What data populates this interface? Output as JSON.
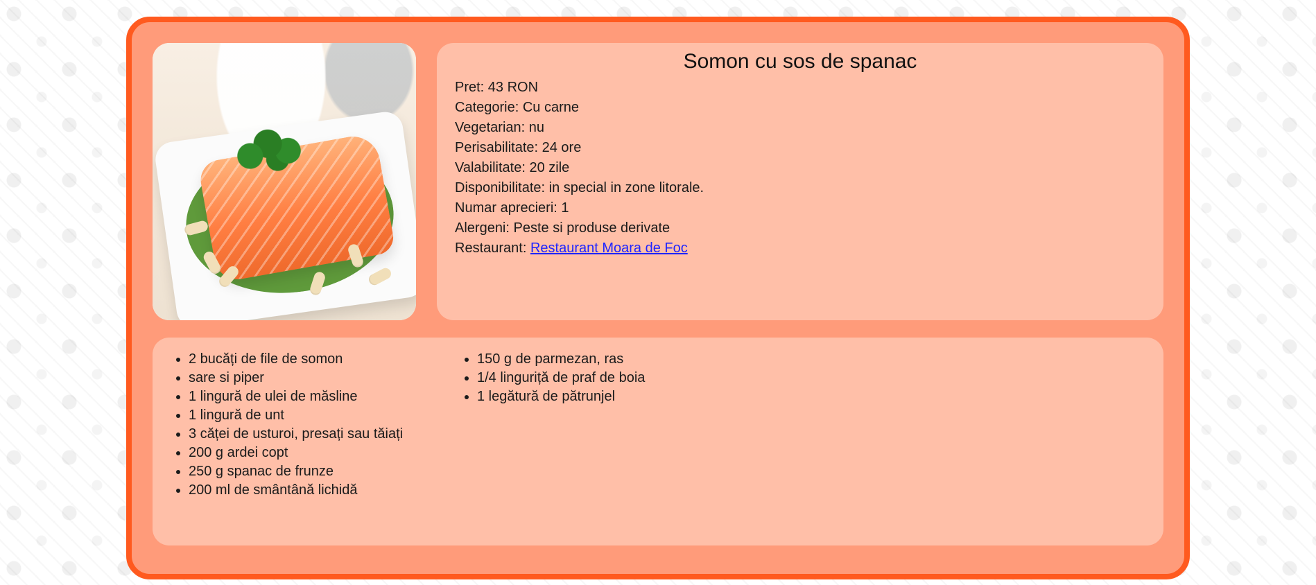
{
  "dish": {
    "title": "Somon cu sos de spanac",
    "details": {
      "pret": "Pret: 43 RON",
      "categorie": "Categorie: Cu carne",
      "vegetarian": "Vegetarian: nu",
      "perisabilitate": "Perisabilitate: 24 ore",
      "valabilitate": "Valabilitate: 20 zile",
      "disponibilitate": "Disponibilitate: in special in zone litorale.",
      "aprecieri": "Numar aprecieri: 1",
      "alergeni": "Alergeni: Peste si produse derivate",
      "restaurant_label": "Restaurant:",
      "restaurant_link": "Restaurant Moara de Foc"
    },
    "ingredients_left": [
      "2 bucăți de file de somon",
      "sare si piper",
      "1 lingură de ulei de măsline",
      "1 lingură de unt",
      "3 căței de usturoi, presați sau tăiați",
      "200 g ardei copt",
      "250 g spanac de frunze",
      "200 ml de smântână lichidă"
    ],
    "ingredients_right": [
      "150 g de parmezan, ras",
      "1/4 linguriță de praf de boia",
      "1 legătură de pătrunjel"
    ]
  },
  "theme": {
    "outer_border": "#ff5a1f",
    "card_fill": "#ff9b7a",
    "panel_fill": "rgba(255, 220, 205, 0.55)",
    "link": "#1f24ff"
  },
  "icons": {
    "background_pattern": "food-doodle-pattern-icon"
  }
}
